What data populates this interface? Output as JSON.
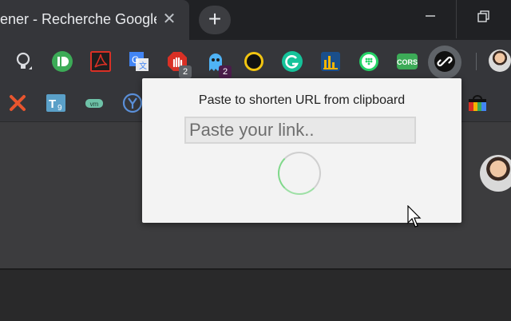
{
  "tab": {
    "title": "ener - Recherche Google",
    "close_glyph": "✕"
  },
  "new_tab_glyph": "+",
  "window": {
    "minimize_glyph": "—"
  },
  "extensions": [
    {
      "name": "lightbulb-extension",
      "color": "#9aa0a6"
    },
    {
      "name": "pushbullet-extension",
      "color": "#3cab57"
    },
    {
      "name": "acrobat-extension",
      "color": "#d93025"
    },
    {
      "name": "google-translate-extension",
      "color": "#4285f4"
    },
    {
      "name": "adblock-extension",
      "color": "#d93025",
      "badge": "2"
    },
    {
      "name": "ghostery-extension",
      "color": "#4fb3f6",
      "badge": "2"
    },
    {
      "name": "dark-mode-extension",
      "color": "#f2c511"
    },
    {
      "name": "grammarly-extension",
      "color": "#15c39a"
    },
    {
      "name": "analytics-extension",
      "color": "#f4b400"
    },
    {
      "name": "whatsapp-extension",
      "color": "#25d366"
    },
    {
      "name": "cors-extension",
      "color": "#3cab57",
      "label": "CORS"
    },
    {
      "name": "link-shortener-extension",
      "color": "#000000"
    }
  ],
  "bookmarks": [
    {
      "name": "x-bookmark",
      "label": "X",
      "color": "#e8552e"
    },
    {
      "name": "t9-bookmark",
      "label": "T9",
      "color": "#5aa0c8"
    },
    {
      "name": "vmware-bookmark",
      "label": "vm",
      "color": "#6ec2a8"
    },
    {
      "name": "y-bookmark",
      "label": "Y",
      "color": "#5a8fd8"
    }
  ],
  "popup": {
    "title": "Paste to shorten URL from clipboard",
    "input_placeholder": "Paste your link.."
  }
}
